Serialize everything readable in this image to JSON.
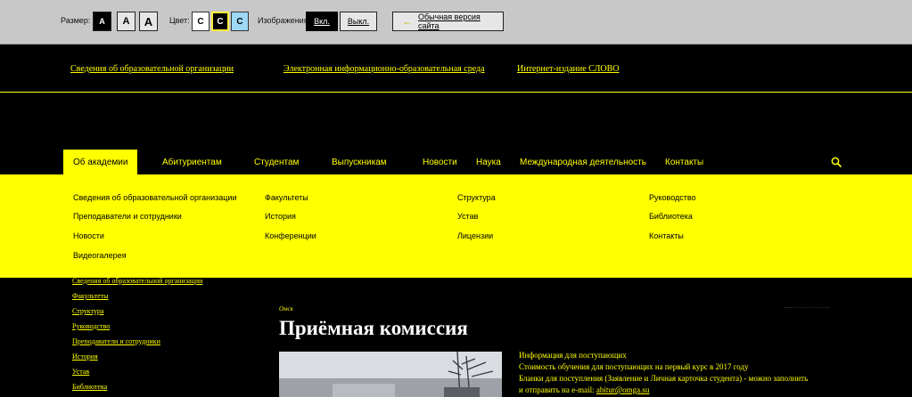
{
  "accessibility_bar": {
    "size_label": "Размер:",
    "size_buttons": [
      "A",
      "A",
      "A"
    ],
    "color_label": "Цвет:",
    "color_buttons": [
      "C",
      "C",
      "C"
    ],
    "images_label": "Изображения",
    "images_on": "Вкл.",
    "images_off": "Выкл.",
    "normal_version": "Обычная версия сайта"
  },
  "top_links": [
    "Сведения об образовательной организации",
    "Электронная информационно-образовательная среда",
    "Интернет-издание СЛОВО"
  ],
  "main_nav": [
    "Об академии",
    "Абитуриентам",
    "Студентам",
    "Выпускникам",
    "Новости",
    "Наука",
    "Международная деятельность",
    "Контакты"
  ],
  "dropdown": {
    "col1": [
      "Сведения об образовательной организации",
      "Преподаватели и сотрудники",
      "Новости",
      "Видеогалерея"
    ],
    "col2": [
      "Факультеты",
      "История",
      "Конференции"
    ],
    "col3": [
      "Структура",
      "Устав",
      "Лицензии"
    ],
    "col4": [
      "Руководство",
      "Библиотека",
      "Контакты"
    ]
  },
  "side_nav": [
    "Сведения об образовательной организации",
    "Факультеты",
    "Структура",
    "Руководство",
    "Преподаватели и сотрудники",
    "История",
    "Устав",
    "Библиотека"
  ],
  "content": {
    "breadcrumb": "Омск",
    "title": "Приёмная комиссия",
    "info": {
      "line1": "Информация для поступающих",
      "line2": "Стоимость обучения для поступающих на первый курс в 2017 году",
      "line3": "Бланки для поступления (Заявление и Личная карточка студента) - можно заполнить",
      "line4_prefix": "и отправить на e-mail: ",
      "email": "abitur@omga.su"
    }
  },
  "colors": {
    "accent": "#ffff00",
    "background": "#000000",
    "toolbar": "#c8c8c8"
  }
}
